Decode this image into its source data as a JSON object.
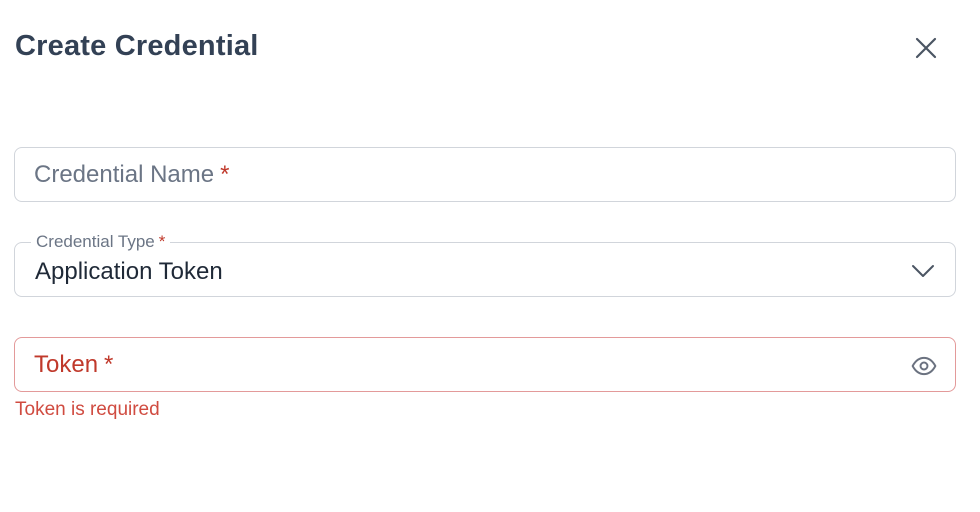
{
  "dialog": {
    "title": "Create Credential",
    "close_icon": "close-icon"
  },
  "fields": {
    "credential_name": {
      "placeholder": "Credential Name",
      "required_mark": "*",
      "value": ""
    },
    "credential_type": {
      "label": "Credential Type",
      "required_mark": "*",
      "selected": "Application Token",
      "icon": "chevron-down-icon"
    },
    "token": {
      "placeholder": "Token",
      "required_mark": "*",
      "value": "",
      "icon": "eye-icon",
      "error": "Token is required"
    }
  },
  "colors": {
    "title": "#334155",
    "error": "#d04b40",
    "error_border": "#e39a9a",
    "border": "#d1d5db",
    "muted_text": "#6b7585"
  }
}
